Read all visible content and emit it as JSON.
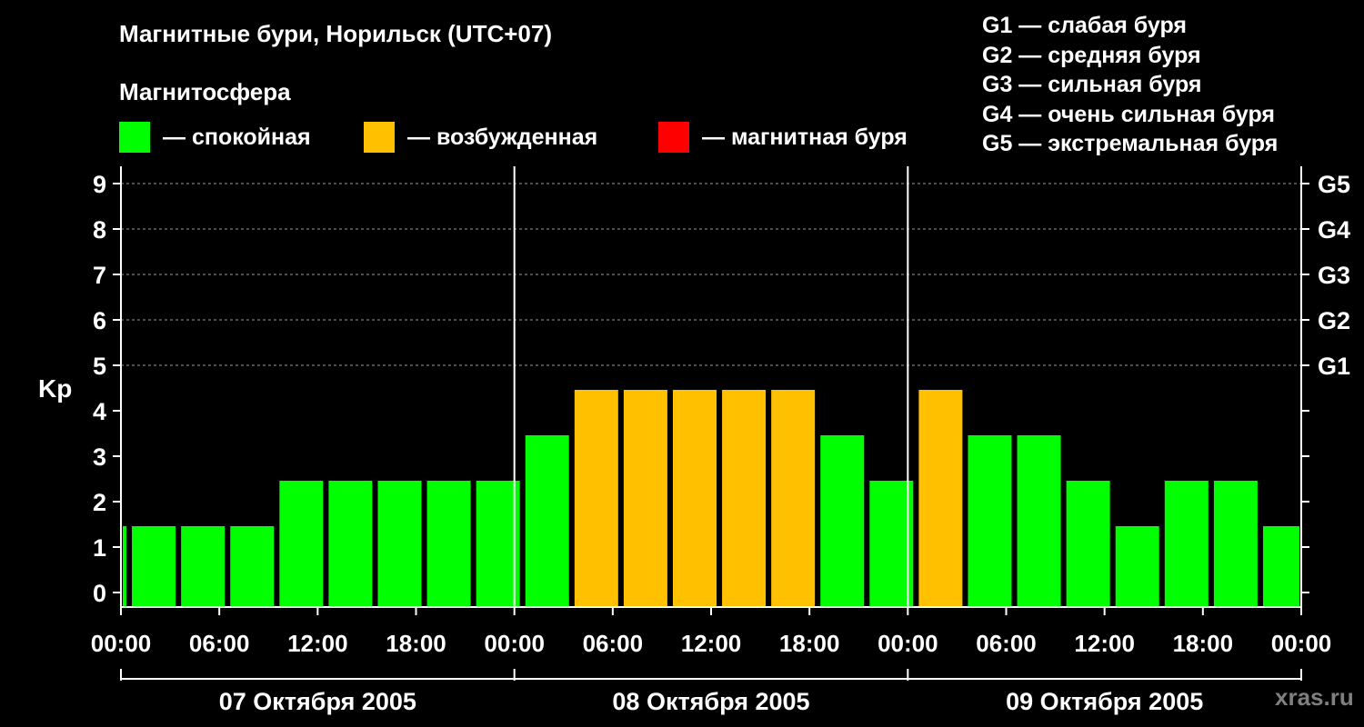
{
  "title": "Магнитные бури, Норильск (UTC+07)",
  "subtitle": "Магнитосфера",
  "legend": [
    {
      "label": "— спокойная",
      "color": "#00ff00"
    },
    {
      "label": "— возбужденная",
      "color": "#ffc000"
    },
    {
      "label": "— магнитная буря",
      "color": "#ff0000"
    }
  ],
  "storm_levels": [
    "G1 — слабая буря",
    "G2 — средняя буря",
    "G3 — сильная буря",
    "G4 — очень сильная буря",
    "G5 — экстремальная буря"
  ],
  "watermark": "xras.ru",
  "chart_data": {
    "type": "bar",
    "ylabel": "Kp",
    "ylim": [
      0,
      9
    ],
    "yticks": [
      "0",
      "1",
      "2",
      "3",
      "4",
      "5",
      "6",
      "7",
      "8",
      "9"
    ],
    "right_axis_labels": [
      {
        "kp": 5,
        "label": "G1"
      },
      {
        "kp": 6,
        "label": "G2"
      },
      {
        "kp": 7,
        "label": "G3"
      },
      {
        "kp": 8,
        "label": "G4"
      },
      {
        "kp": 9,
        "label": "G5"
      }
    ],
    "grid": true,
    "xlim_hours": [
      0,
      72
    ],
    "x_tick_labels": [
      "00:00",
      "06:00",
      "12:00",
      "18:00",
      "00:00",
      "06:00",
      "12:00",
      "18:00",
      "00:00",
      "06:00",
      "12:00",
      "18:00",
      "00:00"
    ],
    "days": [
      "07 Октября 2005",
      "08 Октября 2005",
      "09 Октября 2005"
    ],
    "bar_interval_hours": 3,
    "first_bar_center_hour": -1,
    "values": [
      1,
      1,
      1,
      1,
      2,
      2,
      2,
      2,
      2,
      3,
      4,
      4,
      4,
      4,
      4,
      3,
      2,
      4,
      3,
      3,
      2,
      1,
      2,
      2,
      1
    ],
    "colors": {
      "quiet": "#00ff00",
      "disturbed": "#ffc000",
      "storm": "#ff0000"
    }
  }
}
